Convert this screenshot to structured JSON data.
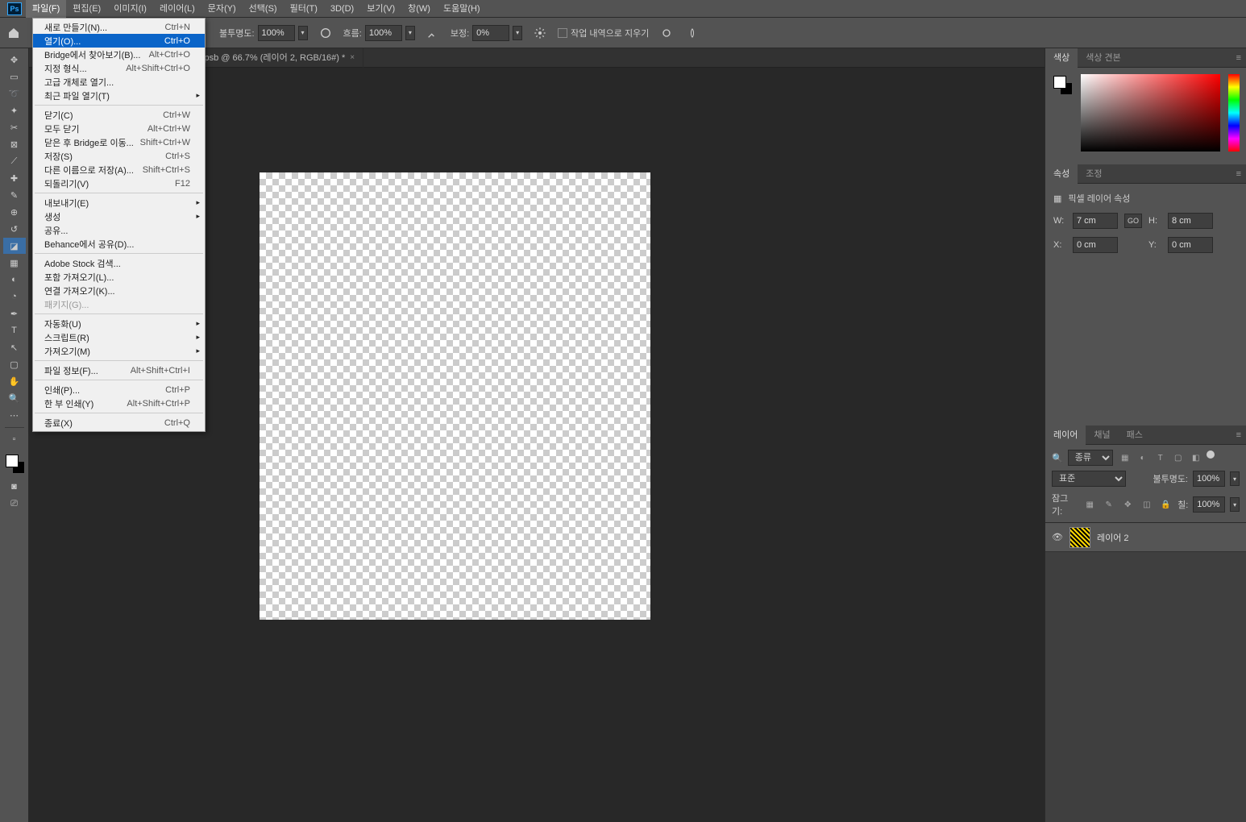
{
  "menubar": {
    "items": [
      "파일(F)",
      "편집(E)",
      "이미지(I)",
      "레이어(L)",
      "문자(Y)",
      "선택(S)",
      "필터(T)",
      "3D(D)",
      "보기(V)",
      "창(W)",
      "도움말(H)"
    ]
  },
  "optionsbar": {
    "opacity_label": "불투명도:",
    "opacity_value": "100%",
    "flow_label": "흐름:",
    "flow_value": "100%",
    "smoothing_label": "보정:",
    "smoothing_value": "0%",
    "erase_history_label": "작업 내역으로 지우기"
  },
  "tabs": [
    {
      "label": "RGB/16#) *"
    },
    {
      "label": "ADD YOUR DESIGN12.psb @ 66.7% (레이어 2, RGB/16#) *"
    }
  ],
  "file_menu": {
    "groups": [
      [
        {
          "label": "새로 만들기(N)...",
          "shortcut": "Ctrl+N"
        },
        {
          "label": "열기(O)...",
          "shortcut": "Ctrl+O",
          "highlight": true
        },
        {
          "label": "Bridge에서 찾아보기(B)...",
          "shortcut": "Alt+Ctrl+O"
        },
        {
          "label": "지정 형식...",
          "shortcut": "Alt+Shift+Ctrl+O"
        },
        {
          "label": "고급 개체로 열기..."
        },
        {
          "label": "최근 파일 열기(T)",
          "submenu": true
        }
      ],
      [
        {
          "label": "닫기(C)",
          "shortcut": "Ctrl+W"
        },
        {
          "label": "모두 닫기",
          "shortcut": "Alt+Ctrl+W"
        },
        {
          "label": "닫은 후 Bridge로 이동...",
          "shortcut": "Shift+Ctrl+W"
        },
        {
          "label": "저장(S)",
          "shortcut": "Ctrl+S"
        },
        {
          "label": "다른 이름으로 저장(A)...",
          "shortcut": "Shift+Ctrl+S"
        },
        {
          "label": "되돌리기(V)",
          "shortcut": "F12"
        }
      ],
      [
        {
          "label": "내보내기(E)",
          "submenu": true
        },
        {
          "label": "생성",
          "submenu": true
        },
        {
          "label": "공유..."
        },
        {
          "label": "Behance에서 공유(D)..."
        }
      ],
      [
        {
          "label": "Adobe Stock 검색..."
        },
        {
          "label": "포함 가져오기(L)..."
        },
        {
          "label": "연결 가져오기(K)..."
        },
        {
          "label": "패키지(G)...",
          "disabled": true
        }
      ],
      [
        {
          "label": "자동화(U)",
          "submenu": true
        },
        {
          "label": "스크립트(R)",
          "submenu": true
        },
        {
          "label": "가져오기(M)",
          "submenu": true
        }
      ],
      [
        {
          "label": "파일 정보(F)...",
          "shortcut": "Alt+Shift+Ctrl+I"
        }
      ],
      [
        {
          "label": "인쇄(P)...",
          "shortcut": "Ctrl+P"
        },
        {
          "label": "한 부 인쇄(Y)",
          "shortcut": "Alt+Shift+Ctrl+P"
        }
      ],
      [
        {
          "label": "종료(X)",
          "shortcut": "Ctrl+Q"
        }
      ]
    ]
  },
  "panels": {
    "color": {
      "tabs": [
        "색상",
        "색상 견본"
      ]
    },
    "properties": {
      "tabs": [
        "속성",
        "조정"
      ],
      "title": "픽셀 레이어 속성",
      "w_label": "W:",
      "w_value": "7 cm",
      "h_label": "H:",
      "h_value": "8 cm",
      "x_label": "X:",
      "x_value": "0 cm",
      "y_label": "Y:",
      "y_value": "0 cm",
      "link": "GO"
    },
    "layers": {
      "tabs": [
        "레이어",
        "채널",
        "패스"
      ],
      "kind_label": "종류",
      "blend_mode": "표준",
      "opacity_label": "불투명도:",
      "opacity_value": "100%",
      "lock_label": "잠그기:",
      "fill_label": "칠:",
      "fill_value": "100%",
      "items": [
        {
          "name": "레이어 2"
        }
      ]
    }
  }
}
